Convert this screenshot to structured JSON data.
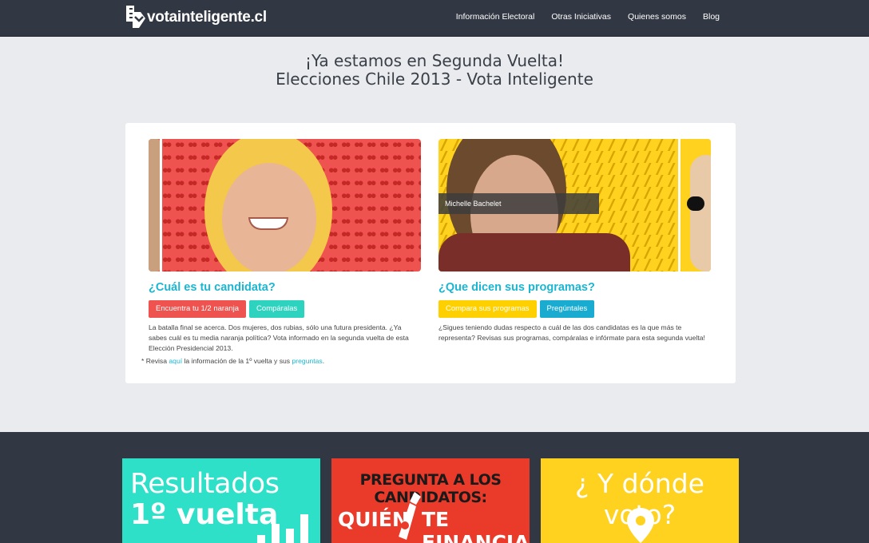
{
  "header": {
    "logo_text": "votainteligente.cl",
    "nav": [
      "Información Electoral",
      "Otras Iniciativas",
      "Quienes somos",
      "Blog"
    ]
  },
  "hero": {
    "line1": "¡Ya estamos en Segunda Vuelta!",
    "line2": "Elecciones Chile 2013 - Vota Inteligente"
  },
  "left": {
    "title": "¿Cuál es tu candidata?",
    "btn1": "Encuentra tu 1/2 naranja",
    "btn2": "Compáralas",
    "desc": "La batalla final se acerca. Dos mujeres, dos rubias, sólo una futura presidenta. ¿Ya sabes cuál es tu media naranja política? Vota informado en la segunda vuelta de esta Elección Presidencial 2013."
  },
  "right": {
    "title": "¿Que dicen sus programas?",
    "caption": "Michelle Bachelet",
    "btn1": "Compara sus programas",
    "btn2": "Pregúntales",
    "desc": "¿Sigues teniendo dudas respecto a cuál de las dos candidatas es la que más te representa? Revisas sus programas, compáralas e infórmate para esta segunda vuelta!"
  },
  "note": {
    "prefix": "* Revisa ",
    "link1": "aquí",
    "middle": " la información de la 1º vuelta y sus ",
    "link2": "preguntas",
    "suffix": "."
  },
  "tiles": {
    "results_l1": "Resultados",
    "results_l2": "1º vuelta",
    "ask_l1": "PREGUNTA A LOS CANDIDATOS:",
    "ask_l2": "QUIÉN",
    "ask_l3": "TE FINANCIA?",
    "where_l1": "¿ Y dónde voto?"
  },
  "colors": {
    "accent": "#1bb6d1",
    "header_bg": "#323843",
    "red": "#ef5350",
    "teal": "#2dd3bf",
    "yellow": "#ffd000"
  }
}
